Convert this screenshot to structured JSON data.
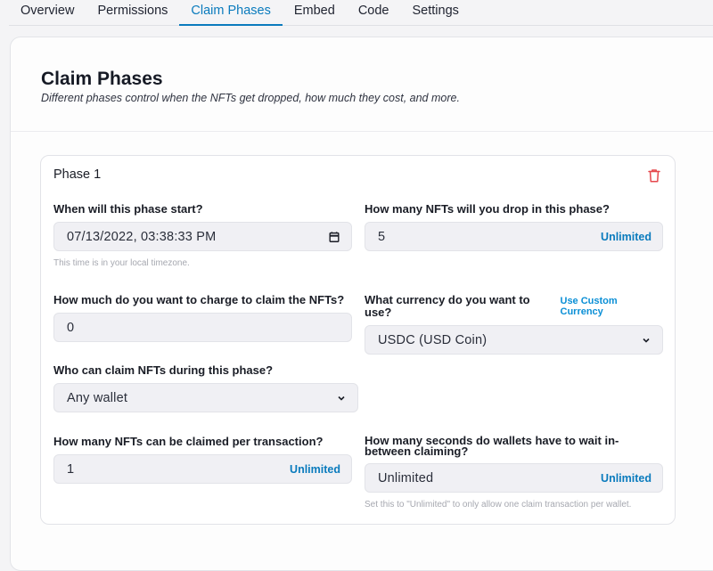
{
  "tabs": [
    {
      "label": "Overview",
      "active": false
    },
    {
      "label": "Permissions",
      "active": false
    },
    {
      "label": "Claim Phases",
      "active": true
    },
    {
      "label": "Embed",
      "active": false
    },
    {
      "label": "Code",
      "active": false
    },
    {
      "label": "Settings",
      "active": false
    }
  ],
  "header": {
    "title": "Claim Phases",
    "subtitle": "Different phases control when the NFTs get dropped, how much they cost, and more."
  },
  "phase": {
    "title": "Phase 1",
    "delete_icon": "trash-icon",
    "start": {
      "label": "When will this phase start?",
      "value": "07/13/2022, 03:38:33 PM",
      "icon": "calendar-icon",
      "helper": "This time is in your local timezone."
    },
    "drop_count": {
      "label": "How many NFTs will you drop in this phase?",
      "value": "5",
      "button": "Unlimited"
    },
    "price": {
      "label": "How much do you want to charge to claim the NFTs?",
      "value": "0"
    },
    "currency": {
      "label": "What currency do you want to use?",
      "link": "Use Custom Currency",
      "value": "USDC (USD Coin)"
    },
    "who": {
      "label": "Who can claim NFTs during this phase?",
      "value": "Any wallet"
    },
    "per_tx": {
      "label": "How many NFTs can be claimed per transaction?",
      "value": "1",
      "button": "Unlimited"
    },
    "wait": {
      "label": "How many seconds do wallets have to wait in-between claiming?",
      "value": "Unlimited",
      "button": "Unlimited",
      "helper": "Set this to \"Unlimited\" to only allow one claim transaction per wallet."
    }
  },
  "colors": {
    "accent": "#0a7bbd",
    "link": "#0a8fd6",
    "danger": "#e5484d",
    "input_bg": "#f0f0f4"
  }
}
